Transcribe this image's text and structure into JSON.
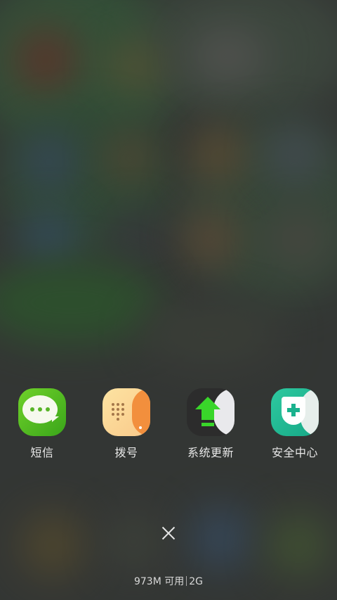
{
  "apps": [
    {
      "label": "短信",
      "icon": "sms-icon"
    },
    {
      "label": "拨号",
      "icon": "dialer-icon"
    },
    {
      "label": "系统更新",
      "icon": "system-update-icon"
    },
    {
      "label": "安全中心",
      "icon": "security-center-icon"
    }
  ],
  "close_icon": "close-icon",
  "memory": {
    "available": "973M 可用",
    "total": "2G"
  },
  "colors": {
    "sms": "#4fbf22",
    "dialer": "#f28f3d",
    "update_arrow": "#39d62a",
    "security": "#1bb28e"
  }
}
